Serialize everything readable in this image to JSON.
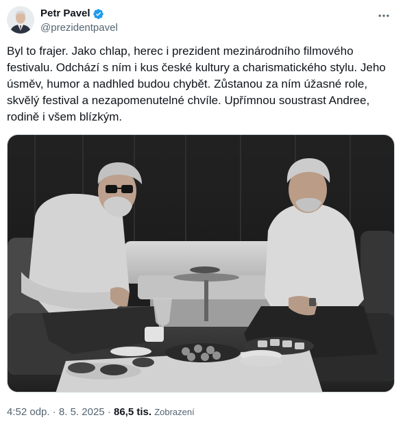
{
  "author": {
    "display_name": "Petr Pavel",
    "handle": "@prezidentpavel",
    "verified_color": "#1d9bf0"
  },
  "tweet": {
    "text": "Byl to frajer. Jako chlap, herec i prezident mezinárodního filmového\nfestivalu. Odchází s ním i kus české kultury a charismatického stylu. Jeho\núsměv, humor a nadhled budou chybět. Zůstanou za ním úžasné role,\nskvělý festival a nezapomenutelné chvíle. Upřímnou soustrast Andree,\nrodině i všem blízkým."
  },
  "media": {
    "style": "black-and-white"
  },
  "meta": {
    "time": "4:52 odp.",
    "separator": "·",
    "date": "8. 5. 2025",
    "views_count": "86,5 tis.",
    "views_label": "Zobrazení"
  },
  "colors": {
    "text": "#0f1419",
    "secondary": "#536471",
    "border": "#cfd9de"
  },
  "icons": {
    "more": "more-horizontal-icon",
    "verified": "verified-badge-icon"
  }
}
